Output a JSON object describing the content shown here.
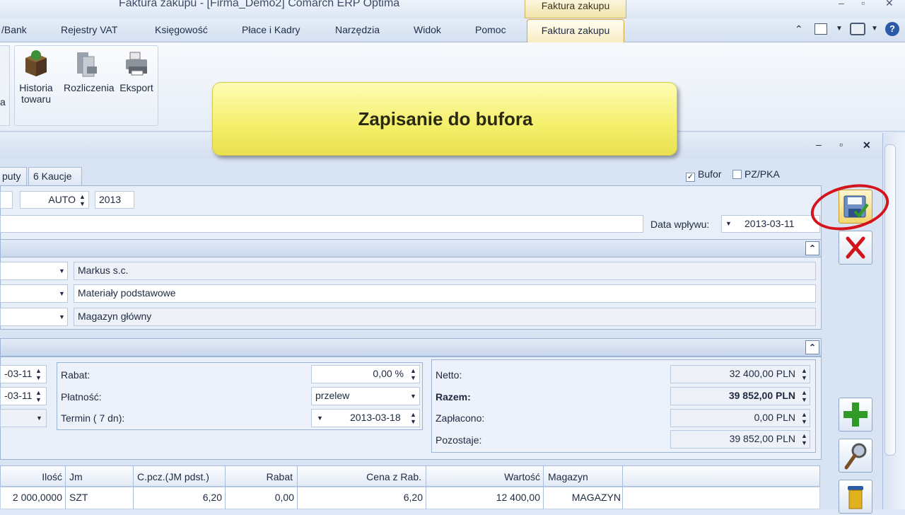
{
  "titlebar": {
    "app_title": "Faktura zakupu  - [Firma_Demo2] Comarch ERP Optima",
    "contextual_title": "Faktura zakupu",
    "minimize": "–",
    "restore": "▫",
    "close": "✕"
  },
  "menu_tabs": [
    {
      "label": "/Bank"
    },
    {
      "label": "Rejestry VAT"
    },
    {
      "label": "Księgowość"
    },
    {
      "label": "Płace i Kadry"
    },
    {
      "label": "Narzędzia"
    },
    {
      "label": "Widok"
    },
    {
      "label": "Pomoc"
    },
    {
      "label": "Faktura zakupu"
    }
  ],
  "ribbon": {
    "left_cut_label": "a",
    "buttons": [
      {
        "label_line1": "Historia",
        "label_line2": "towaru",
        "icon": "history-box-icon"
      },
      {
        "label_line1": "Rozliczenia",
        "label_line2": "",
        "icon": "settlement-docs-icon"
      },
      {
        "label_line1": "Eksport",
        "label_line2": "",
        "icon": "export-printer-icon"
      }
    ]
  },
  "callout": {
    "text": "Zapisanie do bufora"
  },
  "form": {
    "window_controls": {
      "minimize": "–",
      "restore": "▫",
      "close": "✕"
    },
    "subtabs": [
      {
        "label": "puty"
      },
      {
        "label": "6 Kaucje"
      }
    ],
    "bufor": {
      "label": "Bufor",
      "checked": true
    },
    "pzpka": {
      "label": "PZ/PKA",
      "checked": false
    },
    "numbering": {
      "auto": "AUTO",
      "year": "2013"
    },
    "date_received": {
      "label": "Data wpływu:",
      "value": "2013-03-11"
    },
    "contractor": {
      "name": "Markus s.c.",
      "category": "Materiały podstawowe",
      "warehouse": "Magazyn główny"
    },
    "left_dates": [
      "-03-11",
      "-03-11"
    ],
    "rabat": {
      "label": "Rabat:",
      "value": "0,00 %"
    },
    "platnosc": {
      "label": "Płatność:",
      "value": "przelew"
    },
    "termin": {
      "label": "Termin  (    7 dn):",
      "value": "2013-03-18"
    },
    "totals": [
      {
        "label": "Netto:",
        "value": "32 400,00 PLN",
        "bold": false
      },
      {
        "label": "Razem:",
        "value": "39 852,00 PLN",
        "bold": true
      },
      {
        "label": "Zapłacono:",
        "value": "0,00 PLN",
        "bold": false
      },
      {
        "label": "Pozostaje:",
        "value": "39 852,00 PLN",
        "bold": false
      }
    ]
  },
  "grid": {
    "headers": [
      "Ilość",
      "Jm",
      "C.pcz.(JM pdst.)",
      "Rabat",
      "Cena z Rab.",
      "Wartość",
      "Magazyn"
    ],
    "rows": [
      [
        "2 000,0000",
        "SZT",
        "6,20",
        "0,00",
        "6,20",
        "12 400,00",
        "MAGAZYN"
      ]
    ]
  },
  "side_buttons": [
    {
      "icon": "save-to-buffer-icon"
    },
    {
      "icon": "cancel-icon"
    },
    {
      "icon": "add-icon"
    },
    {
      "icon": "magnifier-icon"
    },
    {
      "icon": "trash-icon"
    }
  ],
  "colors": {
    "accent_gold": "#d6a640",
    "callout_yellow": "#f4ef6a",
    "highlight_red": "#d4141c",
    "add_green": "#2f9a26"
  }
}
